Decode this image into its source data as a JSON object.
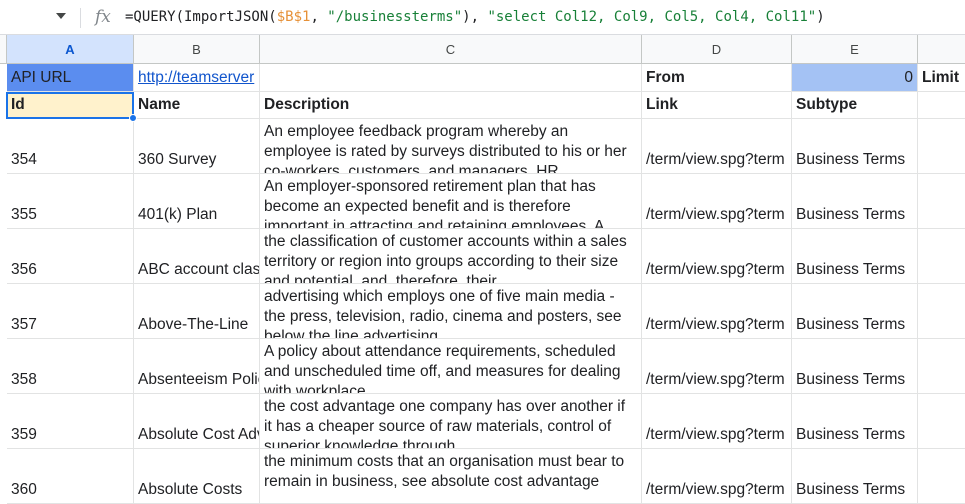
{
  "formula_bar": {
    "fx_label": "fx",
    "formula_parts": [
      {
        "text": "=QUERY(ImportJSON(",
        "kind": "plain"
      },
      {
        "text": "$B$1",
        "kind": "ref"
      },
      {
        "text": ", ",
        "kind": "plain"
      },
      {
        "text": "\"/businessterms\"",
        "kind": "str"
      },
      {
        "text": "), ",
        "kind": "plain"
      },
      {
        "text": "\"select Col12, Col9, Col5, Col4, Col11\"",
        "kind": "str"
      },
      {
        "text": ")",
        "kind": "plain"
      }
    ]
  },
  "columns": [
    "A",
    "B",
    "C",
    "D",
    "E"
  ],
  "row1": {
    "a": "API URL",
    "b": "http://teamserver",
    "d": "From",
    "e": "0",
    "f": "Limit"
  },
  "headers": {
    "id": "Id",
    "name": "Name",
    "description": "Description",
    "link": "Link",
    "subtype": "Subtype"
  },
  "rows": [
    {
      "id": "354",
      "name": "360 Survey",
      "description": "An employee feedback program whereby an employee is rated by surveys distributed to his or her co-workers, customers, and managers. HR",
      "link": "/term/view.spg?term",
      "subtype": "Business Terms"
    },
    {
      "id": "355",
      "name": "401(k) Plan",
      "description": "An employer-sponsored retirement plan that has become an expected benefit and is therefore important in attracting and retaining employees. A",
      "link": "/term/view.spg?term",
      "subtype": "Business Terms"
    },
    {
      "id": "356",
      "name": "ABC account classification",
      "description": "the classification of customer accounts within a sales territory or region into groups according to their size and potential, and, therefore, their",
      "link": "/term/view.spg?term",
      "subtype": "Business Terms"
    },
    {
      "id": "357",
      "name": "Above-The-Line",
      "description": "advertising which employs one of five main media - the press, television, radio, cinema and posters, see below the line advertising",
      "link": "/term/view.spg?term",
      "subtype": "Business Terms"
    },
    {
      "id": "358",
      "name": "Absenteeism Policy",
      "description": "A policy about attendance requirements, scheduled and unscheduled time off, and measures for dealing with workplace",
      "link": "/term/view.spg?term",
      "subtype": "Business Terms"
    },
    {
      "id": "359",
      "name": "Absolute Cost Advantage",
      "description": "the cost advantage one company has over another if it has a cheaper source of raw materials, control of superior knowledge through",
      "link": "/term/view.spg?term",
      "subtype": "Business Terms"
    },
    {
      "id": "360",
      "name": "Absolute Costs",
      "description": "the minimum costs that an organisation must bear to remain in business, see absolute cost advantage",
      "link": "/term/view.spg?term",
      "subtype": "Business Terms"
    }
  ]
}
